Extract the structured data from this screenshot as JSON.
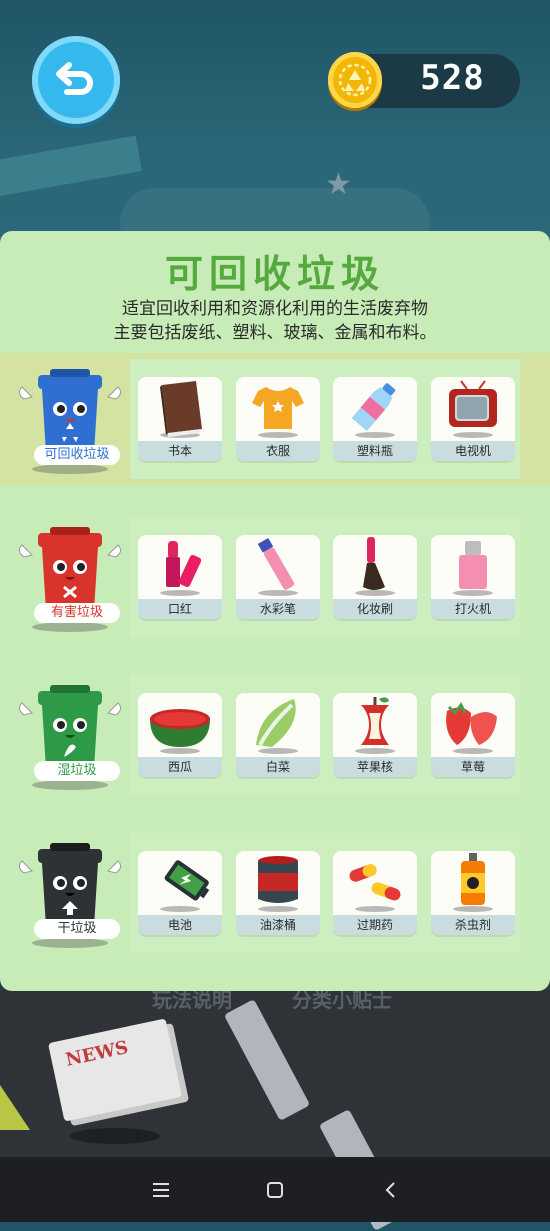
{
  "coins": "528",
  "panel": {
    "title": "可回收垃圾",
    "desc_line1": "适宜回收利用和资源化利用的生活废弃物",
    "desc_line2": "主要包括废纸、塑料、玻璃、金属和布料。"
  },
  "categories": [
    {
      "label": "可回收垃圾",
      "color": "#2e6fd1",
      "items": [
        {
          "label": "书本",
          "icon": "book-icon"
        },
        {
          "label": "衣服",
          "icon": "tshirt-icon"
        },
        {
          "label": "塑料瓶",
          "icon": "plastic-bottle-icon"
        },
        {
          "label": "电视机",
          "icon": "tv-icon"
        }
      ]
    },
    {
      "label": "有害垃圾",
      "color": "#d9342b",
      "items": [
        {
          "label": "口红",
          "icon": "lipstick-icon"
        },
        {
          "label": "水彩笔",
          "icon": "marker-icon"
        },
        {
          "label": "化妆刷",
          "icon": "makeup-brush-icon"
        },
        {
          "label": "打火机",
          "icon": "lighter-icon"
        }
      ]
    },
    {
      "label": "湿垃圾",
      "color": "#2e9a47",
      "items": [
        {
          "label": "西瓜",
          "icon": "watermelon-icon"
        },
        {
          "label": "白菜",
          "icon": "cabbage-icon"
        },
        {
          "label": "苹果核",
          "icon": "apple-core-icon"
        },
        {
          "label": "草莓",
          "icon": "strawberry-icon"
        }
      ]
    },
    {
      "label": "干垃圾",
      "color": "#2f3235",
      "items": [
        {
          "label": "电池",
          "icon": "battery-icon"
        },
        {
          "label": "油漆桶",
          "icon": "paint-bucket-icon"
        },
        {
          "label": "过期药",
          "icon": "capsule-icon"
        },
        {
          "label": "杀虫剂",
          "icon": "insecticide-icon"
        }
      ]
    }
  ],
  "background": {
    "caption_left": "玩法说明",
    "caption_right": "分类小贴士",
    "newspaper": "NEWS"
  }
}
